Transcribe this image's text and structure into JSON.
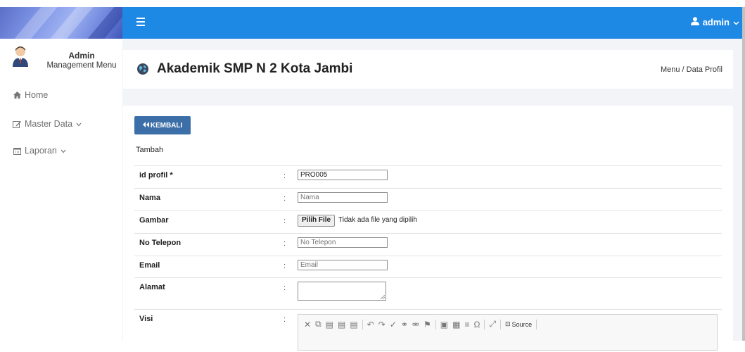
{
  "sidebar": {
    "user": {
      "name": "Admin",
      "role": "Management Menu"
    },
    "items": [
      {
        "label": "Home",
        "icon": "home-icon"
      },
      {
        "label": "Master Data",
        "icon": "edit-icon",
        "has_dropdown": true
      },
      {
        "label": "Laporan",
        "icon": "calendar-icon",
        "has_dropdown": true
      }
    ]
  },
  "topbar": {
    "user_label": "admin",
    "color": "#1e88e5"
  },
  "header": {
    "title": "Akademik SMP N 2 Kota Jambi",
    "breadcrumb": "Menu / Data Profil"
  },
  "form": {
    "back_label": "KEMBALI",
    "subtitle": "Tambah",
    "fields": {
      "id_profil": {
        "label": "id profil *",
        "value": "PRO005"
      },
      "nama": {
        "label": "Nama",
        "placeholder": "Nama"
      },
      "gambar": {
        "label": "Gambar",
        "button": "Pilih File",
        "status": "Tidak ada file yang dipilih"
      },
      "telepon": {
        "label": "No Telepon",
        "placeholder": "No Telepon"
      },
      "email": {
        "label": "Email",
        "placeholder": "Email"
      },
      "alamat": {
        "label": "Alamat"
      },
      "visi": {
        "label": "Visi"
      }
    },
    "editor": {
      "source_label": "Source"
    }
  },
  "colon": ":"
}
